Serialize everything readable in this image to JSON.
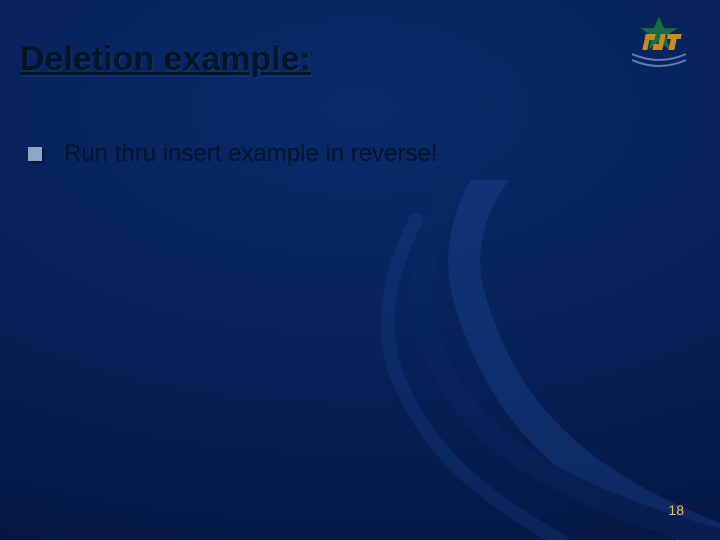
{
  "title": "Deletion example:",
  "bullets": [
    "Run thru insert example in reverse!"
  ],
  "logo": {
    "alt": "UNT logo"
  },
  "page_number": "18"
}
